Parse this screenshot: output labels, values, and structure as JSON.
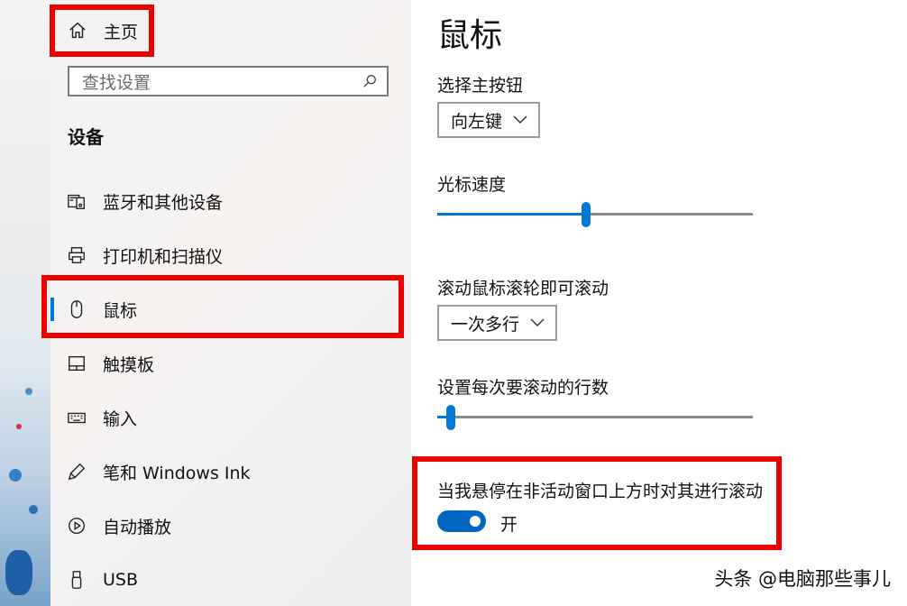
{
  "sidebar": {
    "home_label": "主页",
    "search_placeholder": "查找设置",
    "section_title": "设备",
    "items": [
      {
        "label": "蓝牙和其他设备",
        "icon": "bluetooth-devices-icon"
      },
      {
        "label": "打印机和扫描仪",
        "icon": "printer-icon"
      },
      {
        "label": "鼠标",
        "icon": "mouse-icon",
        "selected": true
      },
      {
        "label": "触摸板",
        "icon": "touchpad-icon"
      },
      {
        "label": "输入",
        "icon": "keyboard-icon"
      },
      {
        "label": "笔和 Windows Ink",
        "icon": "pen-icon"
      },
      {
        "label": "自动播放",
        "icon": "autoplay-icon"
      },
      {
        "label": "USB",
        "icon": "usb-icon"
      }
    ]
  },
  "main": {
    "title": "鼠标",
    "primary_button": {
      "label": "选择主按钮",
      "value": "向左键"
    },
    "cursor_speed": {
      "label": "光标速度",
      "value_fraction": 0.47
    },
    "scroll_mode": {
      "label": "滚动鼠标滚轮即可滚动",
      "value": "一次多行"
    },
    "scroll_lines": {
      "label": "设置每次要滚动的行数",
      "value_fraction": 0.03
    },
    "inactive_scroll": {
      "label": "当我悬停在非活动窗口上方时对其进行滚动",
      "state": "开",
      "on": true
    }
  },
  "watermark": "头条 @电脑那些事儿",
  "colors": {
    "accent": "#0078d4",
    "highlight": "#ee0000"
  }
}
